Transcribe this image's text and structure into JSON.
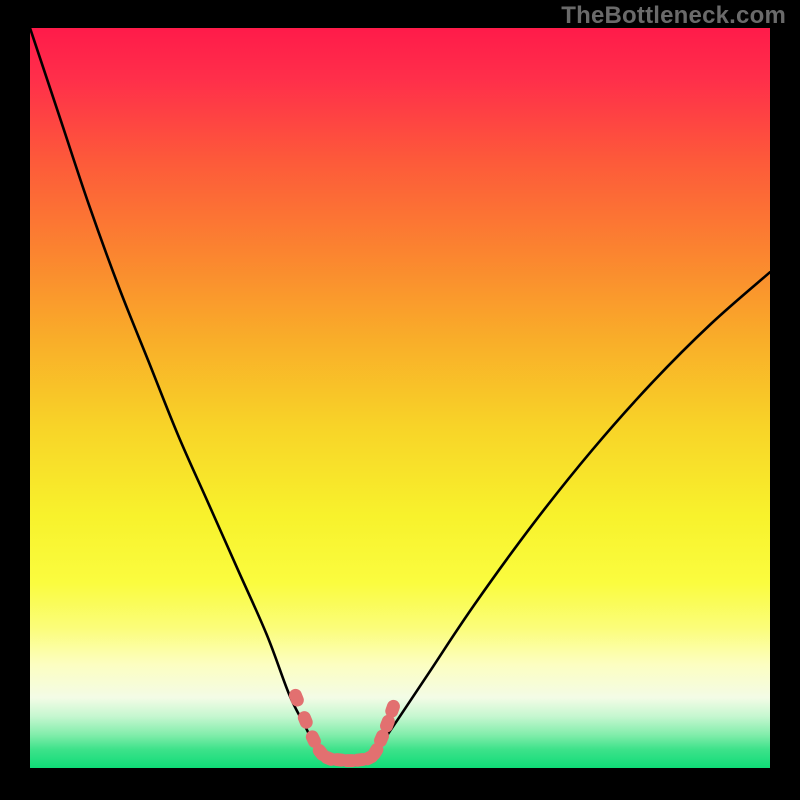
{
  "watermark": "TheBottleneck.com",
  "chart_data": {
    "type": "line",
    "title": "",
    "xlabel": "",
    "ylabel": "",
    "xlim": [
      0,
      100
    ],
    "ylim": [
      0,
      100
    ],
    "series": [
      {
        "name": "left-curve",
        "x": [
          0,
          4,
          8,
          12,
          16,
          20,
          24,
          28,
          32,
          35,
          37,
          38,
          39
        ],
        "y": [
          100,
          88,
          76,
          65,
          55,
          45,
          36,
          27,
          18,
          10,
          6,
          4,
          2
        ]
      },
      {
        "name": "right-curve",
        "x": [
          47,
          48,
          50,
          54,
          60,
          68,
          76,
          84,
          92,
          100
        ],
        "y": [
          2,
          4,
          7,
          13,
          22,
          33,
          43,
          52,
          60,
          67
        ]
      },
      {
        "name": "floor",
        "x": [
          39,
          41,
          43,
          45,
          47
        ],
        "y": [
          1.6,
          1.2,
          1.0,
          1.2,
          1.6
        ]
      }
    ],
    "markers": {
      "name": "trough-markers",
      "color": "#e27070",
      "points": [
        {
          "x": 36.0,
          "y": 9.5
        },
        {
          "x": 37.2,
          "y": 6.5
        },
        {
          "x": 38.3,
          "y": 3.9
        },
        {
          "x": 39.3,
          "y": 2.1
        },
        {
          "x": 40.4,
          "y": 1.3
        },
        {
          "x": 41.8,
          "y": 1.1
        },
        {
          "x": 43.2,
          "y": 1.0
        },
        {
          "x": 44.6,
          "y": 1.1
        },
        {
          "x": 45.9,
          "y": 1.4
        },
        {
          "x": 46.7,
          "y": 2.2
        },
        {
          "x": 47.5,
          "y": 4.0
        },
        {
          "x": 48.3,
          "y": 6.0
        },
        {
          "x": 49.0,
          "y": 8.0
        }
      ]
    },
    "gradient_stops": [
      {
        "offset": 0.0,
        "color": "#ff1b4a"
      },
      {
        "offset": 0.07,
        "color": "#ff2f4a"
      },
      {
        "offset": 0.18,
        "color": "#fd5a3a"
      },
      {
        "offset": 0.3,
        "color": "#fb8330"
      },
      {
        "offset": 0.42,
        "color": "#f9ad29"
      },
      {
        "offset": 0.54,
        "color": "#f8d428"
      },
      {
        "offset": 0.66,
        "color": "#f8f22c"
      },
      {
        "offset": 0.75,
        "color": "#fafc3f"
      },
      {
        "offset": 0.81,
        "color": "#fbfd79"
      },
      {
        "offset": 0.86,
        "color": "#fcfec1"
      },
      {
        "offset": 0.905,
        "color": "#f3fce6"
      },
      {
        "offset": 0.93,
        "color": "#c6f7d0"
      },
      {
        "offset": 0.955,
        "color": "#82edab"
      },
      {
        "offset": 0.975,
        "color": "#3de28a"
      },
      {
        "offset": 1.0,
        "color": "#0fdc77"
      }
    ]
  }
}
